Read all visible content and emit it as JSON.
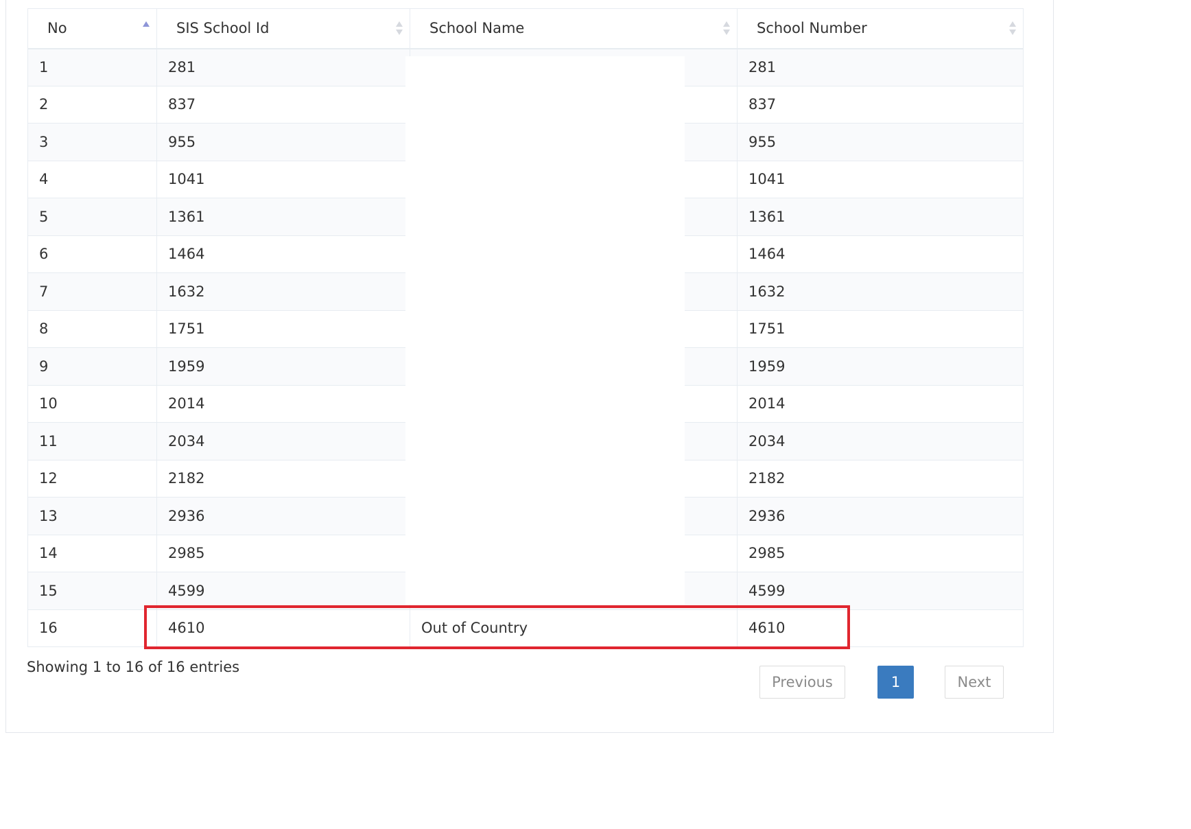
{
  "table": {
    "columns": [
      {
        "label": "No",
        "sort": "asc"
      },
      {
        "label": "SIS School Id",
        "sort": "none"
      },
      {
        "label": "School Name",
        "sort": "none"
      },
      {
        "label": "School Number",
        "sort": "none"
      }
    ],
    "rows": [
      {
        "no": "1",
        "sis_id": "281",
        "name": "",
        "number": "281"
      },
      {
        "no": "2",
        "sis_id": "837",
        "name": "",
        "number": "837"
      },
      {
        "no": "3",
        "sis_id": "955",
        "name": "",
        "number": "955"
      },
      {
        "no": "4",
        "sis_id": "1041",
        "name": "",
        "number": "1041"
      },
      {
        "no": "5",
        "sis_id": "1361",
        "name": "",
        "number": "1361"
      },
      {
        "no": "6",
        "sis_id": "1464",
        "name": "",
        "number": "1464"
      },
      {
        "no": "7",
        "sis_id": "1632",
        "name": "",
        "number": "1632"
      },
      {
        "no": "8",
        "sis_id": "1751",
        "name": "",
        "number": "1751"
      },
      {
        "no": "9",
        "sis_id": "1959",
        "name": "",
        "number": "1959"
      },
      {
        "no": "10",
        "sis_id": "2014",
        "name": "",
        "number": "2014"
      },
      {
        "no": "11",
        "sis_id": "2034",
        "name": "",
        "number": "2034"
      },
      {
        "no": "12",
        "sis_id": "2182",
        "name": "",
        "number": "2182"
      },
      {
        "no": "13",
        "sis_id": "2936",
        "name": "",
        "number": "2936"
      },
      {
        "no": "14",
        "sis_id": "2985",
        "name": "",
        "number": "2985"
      },
      {
        "no": "15",
        "sis_id": "4599",
        "name": "",
        "number": "4599"
      },
      {
        "no": "16",
        "sis_id": "4610",
        "name": "Out of Country",
        "number": "4610"
      }
    ]
  },
  "footer": {
    "info": "Showing 1 to 16 of 16 entries",
    "previous_label": "Previous",
    "current_page": "1",
    "next_label": "Next"
  },
  "colors": {
    "highlight": "#e0262f",
    "pagination_active": "#3a7bbf",
    "sort_active": "#8e95d8"
  }
}
